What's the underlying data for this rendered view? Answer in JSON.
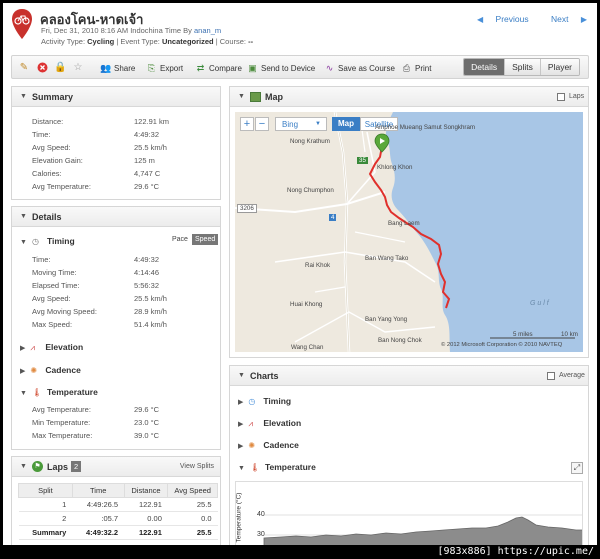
{
  "activity": {
    "title": "คลองโคน-หาดเจ้า",
    "date_line_prefix": "Fri, Dec 31, 2010 8:16 AM Indochina Time By",
    "author": "anan_m",
    "type_label": "Activity Type:",
    "type_value": "Cycling",
    "event_label": "| Event Type:",
    "event_value": "Uncategorized",
    "course_label": "| Course:",
    "course_value": "--"
  },
  "nav": {
    "previous": "Previous",
    "next": "Next"
  },
  "toolbar": {
    "share": "Share",
    "export": "Export",
    "compare": "Compare",
    "send": "Send to Device",
    "save_course": "Save as Course",
    "print": "Print",
    "tabs": [
      "Details",
      "Splits",
      "Player"
    ]
  },
  "summary": {
    "title": "Summary",
    "rows": [
      {
        "label": "Distance:",
        "value": "122.91 km"
      },
      {
        "label": "Time:",
        "value": "4:49:32"
      },
      {
        "label": "Avg Speed:",
        "value": "25.5 km/h"
      },
      {
        "label": "Elevation Gain:",
        "value": "125 m"
      },
      {
        "label": "Calories:",
        "value": "4,747 C"
      },
      {
        "label": "Avg Temperature:",
        "value": "29.6 °C"
      }
    ]
  },
  "details": {
    "title": "Details",
    "timing": {
      "title": "Timing",
      "pace": "Pace",
      "speed": "Speed",
      "rows": [
        {
          "label": "Time:",
          "value": "4:49:32"
        },
        {
          "label": "Moving Time:",
          "value": "4:14:46"
        },
        {
          "label": "Elapsed Time:",
          "value": "5:56:32"
        },
        {
          "label": "Avg Speed:",
          "value": "25.5 km/h"
        },
        {
          "label": "Avg Moving Speed:",
          "value": "28.9 km/h"
        },
        {
          "label": "Max Speed:",
          "value": "51.4 km/h"
        }
      ]
    },
    "elevation": "Elevation",
    "cadence": "Cadence",
    "temperature": {
      "title": "Temperature",
      "rows": [
        {
          "label": "Avg Temperature:",
          "value": "29.6 °C"
        },
        {
          "label": "Min Temperature:",
          "value": "23.0 °C"
        },
        {
          "label": "Max Temperature:",
          "value": "39.0 °C"
        }
      ]
    }
  },
  "laps": {
    "title": "Laps",
    "count": "2",
    "view_splits": "View Splits",
    "headers": [
      "Split",
      "Time",
      "Distance",
      "Avg Speed"
    ],
    "rows": [
      [
        "1",
        "4:49:26.5",
        "122.91",
        "25.5"
      ],
      [
        "2",
        ":05.7",
        "0.00",
        "0.0"
      ],
      [
        "Summary",
        "4:49:32.2",
        "122.91",
        "25.5"
      ]
    ]
  },
  "map": {
    "title": "Map",
    "laps_label": "Laps",
    "provider": "Bing",
    "map_btn": "Map",
    "satellite_btn": "Satellite",
    "labels": {
      "nong_krathum": "Nong Krathum",
      "mueang": "Amphoe Mueang Samut Songkhram",
      "khlong_khon": "Khlong Khon",
      "nong_chumphon": "Nong Chumphon",
      "bang_laem": "Bang Laem",
      "ban_wang_tako": "Ban Wang Tako",
      "rai_khok": "Rai Khok",
      "huai_khong": "Huai Khong",
      "ban_yang_yong": "Ban Yang Yong",
      "ban_nong_chok": "Ban Nong Chok",
      "wang_chan": "Wang Chan",
      "gulf": "G u l f"
    },
    "road_3206": "3206",
    "road_35": "35",
    "road_4": "4",
    "scale_miles": "5 miles",
    "scale_km": "10 km",
    "copyright": "© 2012 Microsoft Corporation  © 2010 NAVTEQ"
  },
  "charts": {
    "title": "Charts",
    "average": "Average",
    "items": [
      "Timing",
      "Elevation",
      "Cadence",
      "Temperature"
    ],
    "temp_axis_label": "Temperature (°C)",
    "ticks": [
      "40",
      "30"
    ]
  },
  "colors": {
    "route": "#e0302c",
    "water": "#a8c6e6",
    "land": "#eee9df",
    "accent": "#3a7ec5"
  }
}
